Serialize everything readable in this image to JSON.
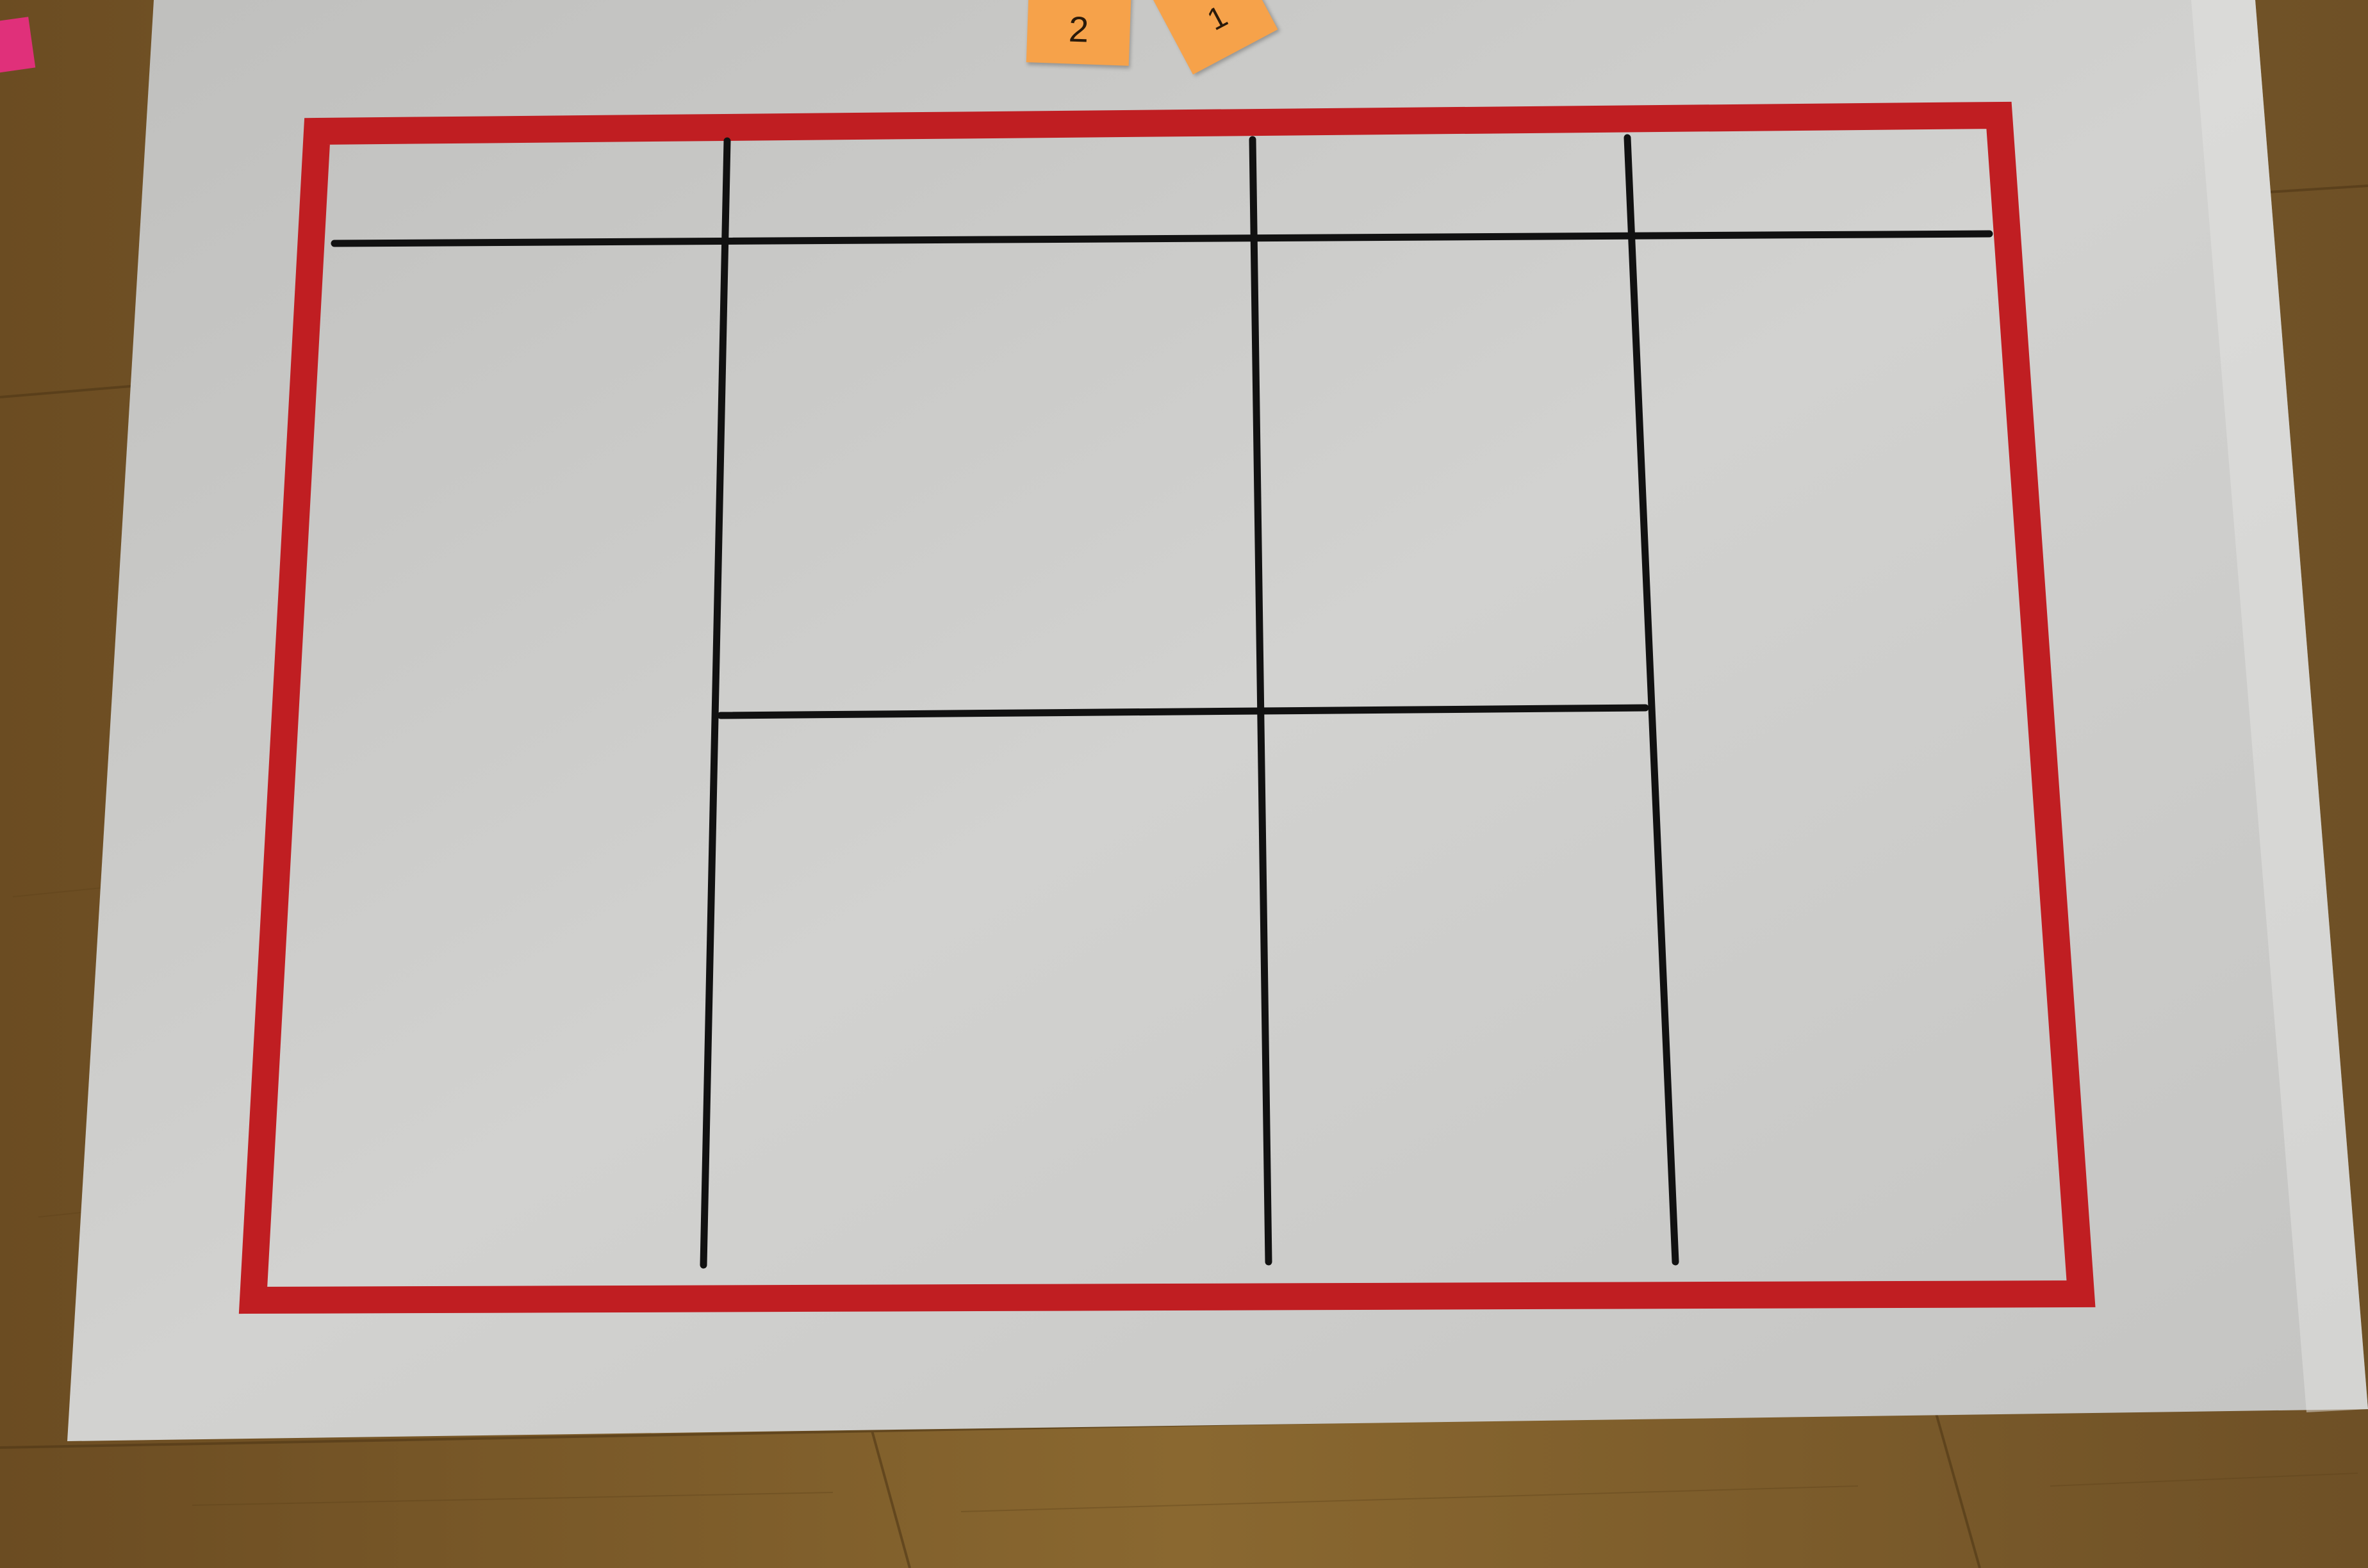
{
  "sticky_notes": [
    {
      "label": "2",
      "color": "#f6a24a"
    },
    {
      "label": "1",
      "color": "#f6a24a"
    }
  ],
  "colors": {
    "paper": "#cfcfcd",
    "outer_border": "#c01e22",
    "grid_lines": "#111111",
    "floor": "#7a5a2c",
    "scrap": "#e0307a"
  },
  "objects": [
    "wooden-floor",
    "white-paper-sheet",
    "red-rectangle-border",
    "black-grid-lines",
    "orange-sticky-note-2",
    "orange-sticky-note-1",
    "pink-paper-scrap"
  ]
}
